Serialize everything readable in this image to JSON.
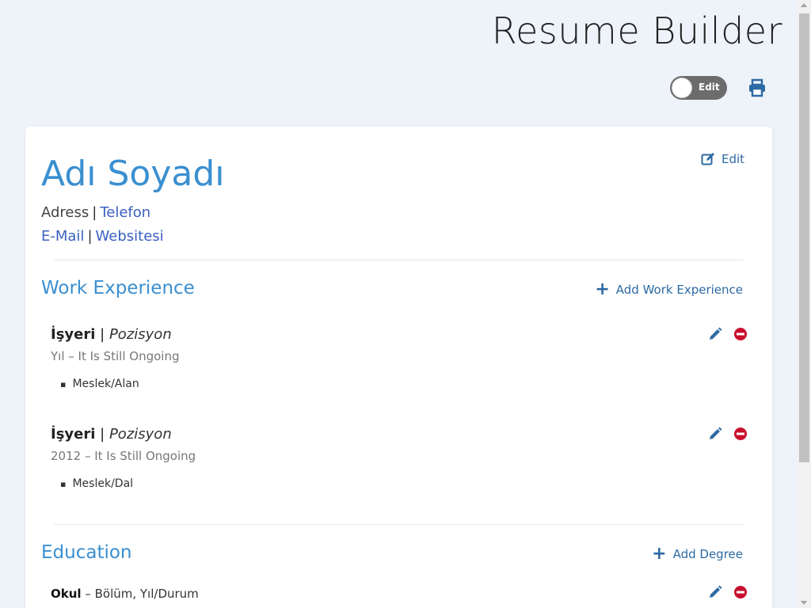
{
  "header": {
    "app_title": "Resume Builder",
    "toggle_label": "Edit",
    "print_icon": "print-icon"
  },
  "profile": {
    "name": "Adı Soyadı",
    "edit_label": "Edit",
    "address": "Adress",
    "phone": "Telefon",
    "email": "E-Mail",
    "website": "Websitesi",
    "separator": "|"
  },
  "work": {
    "title": "Work Experience",
    "add_label": "Add Work Experience",
    "entries": [
      {
        "employer": "İşyeri",
        "position": "Pozisyon",
        "period": "Yıl – It Is Still Ongoing",
        "bullet": "Meslek/Alan"
      },
      {
        "employer": "İşyeri",
        "position": "Pozisyon",
        "period": "2012 – It Is Still Ongoing",
        "bullet": "Meslek/Dal"
      }
    ]
  },
  "education": {
    "title": "Education",
    "add_label": "Add Degree",
    "entries": [
      {
        "school": "Okul",
        "details": " – Bölüm, Yıl/Durum"
      }
    ]
  },
  "colors": {
    "accent": "#3a8fd0",
    "link": "#3b61c0",
    "action": "#2d6aa3",
    "delete": "#c8102e"
  }
}
